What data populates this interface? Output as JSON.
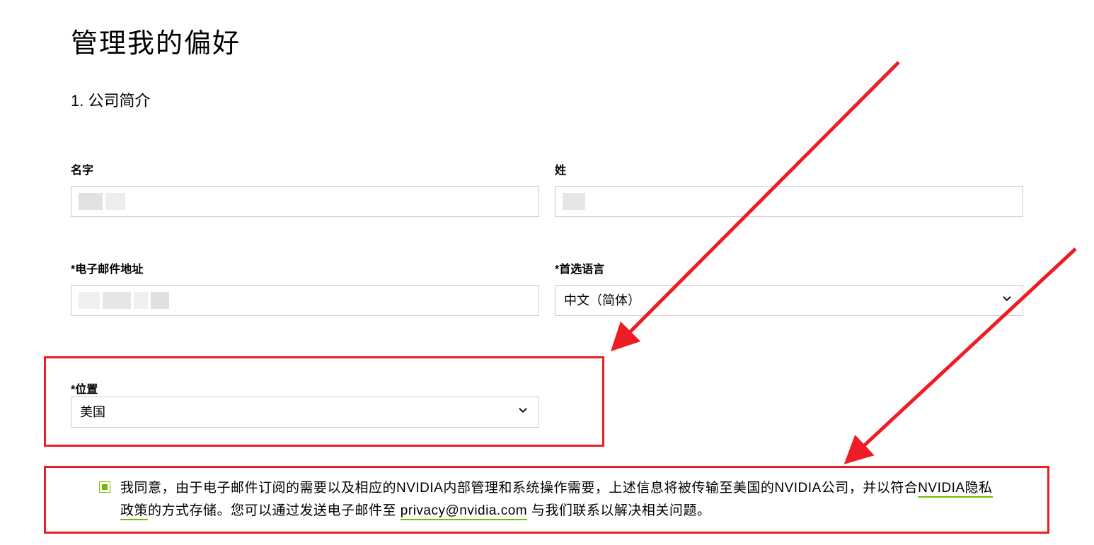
{
  "page": {
    "title": "管理我的偏好",
    "section_heading": "1. 公司简介"
  },
  "fields": {
    "first_name": {
      "label": "名字",
      "value": ""
    },
    "last_name": {
      "label": "姓",
      "value": ""
    },
    "email": {
      "label": "*电子邮件地址",
      "value": ""
    },
    "language": {
      "label": "*首选语言",
      "value": "中文（简体）"
    },
    "location": {
      "label": "*位置",
      "value": "美国"
    }
  },
  "consent": {
    "checked": true,
    "text_part1": "我同意，由于电子邮件订阅的需要以及相应的NVIDIA内部管理和系统操作需要，上述信息将被传输至美国的NVIDIA公司，并以符合",
    "link1": "NVIDIA隐私政策",
    "text_part2": "的方式存储。您可以通过发送电子邮件至 ",
    "link2": "privacy@nvidia.com",
    "text_part3": " 与我们联系以解决相关问题。"
  }
}
